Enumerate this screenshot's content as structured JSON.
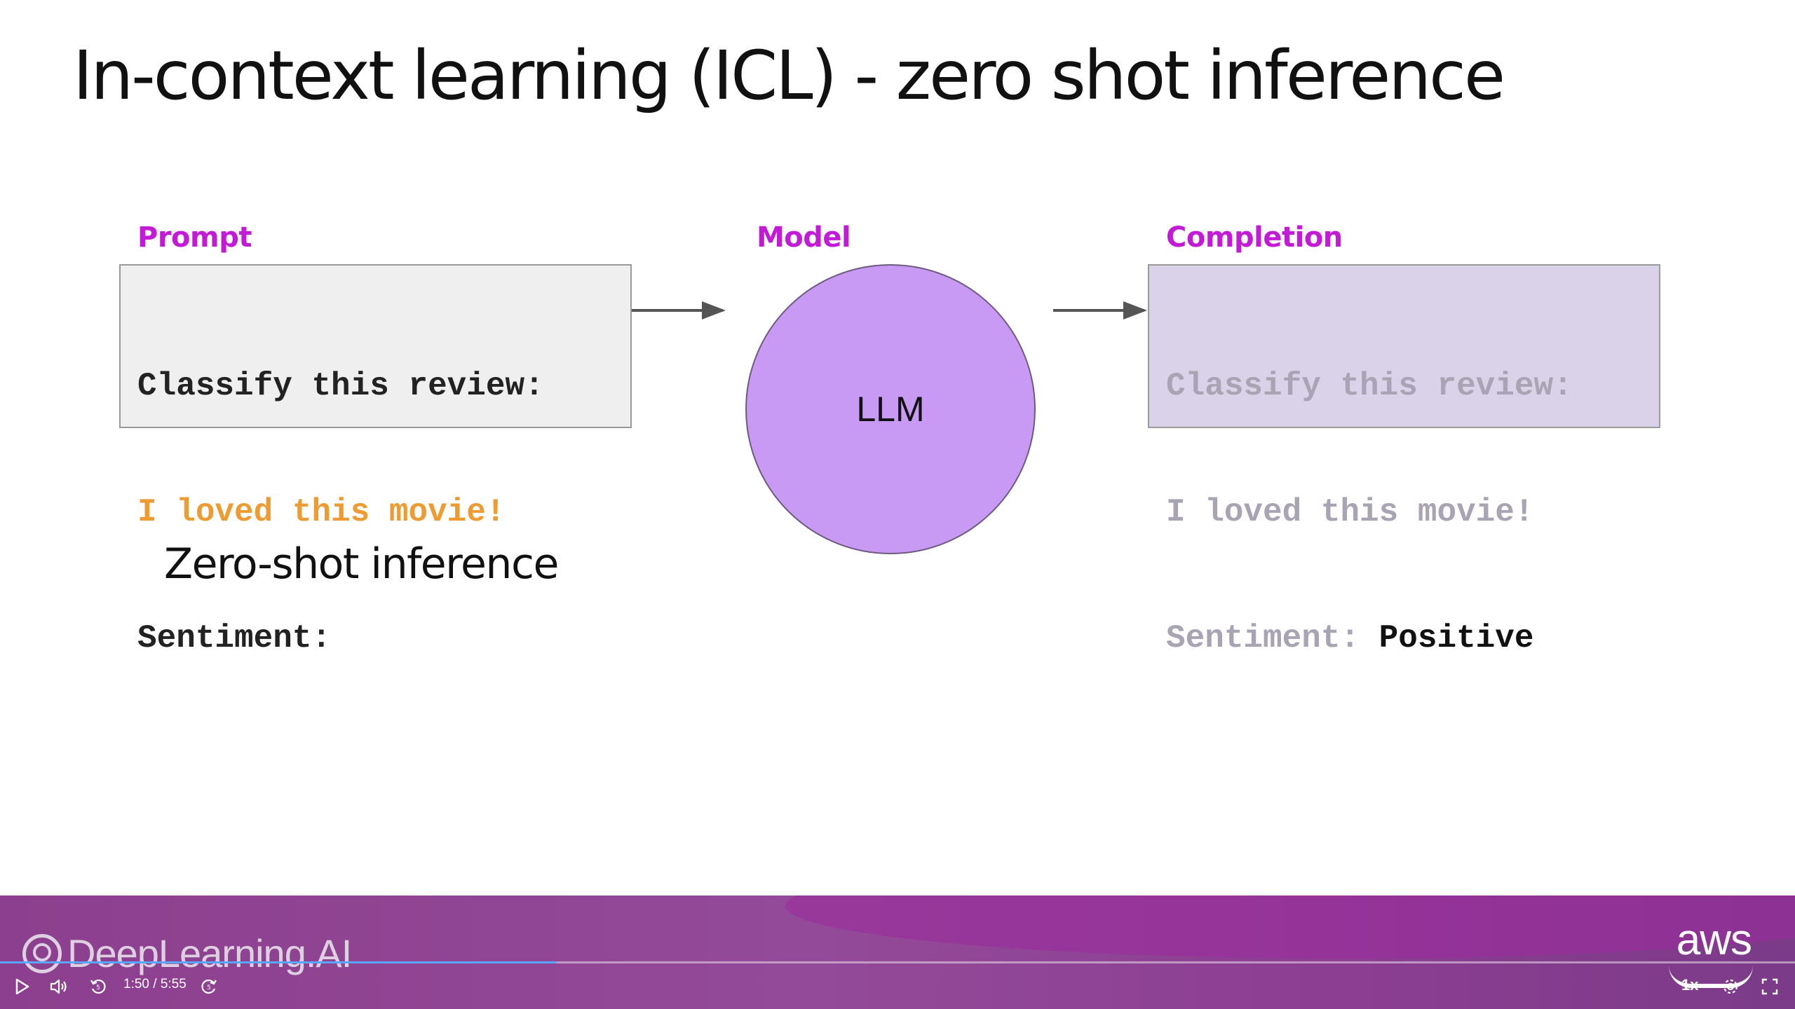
{
  "slide": {
    "title": "In-context learning (ICL) - zero shot inference",
    "labels": {
      "prompt": "Prompt",
      "model": "Model",
      "completion": "Completion"
    },
    "prompt_box": {
      "line1": "Classify this review:",
      "line2": "I loved this movie!",
      "line3": "Sentiment:"
    },
    "model_circle": "LLM",
    "completion_box": {
      "line1": "Classify this review:",
      "line2": "I loved this movie!",
      "line3_prefix": "Sentiment: ",
      "line3_answer": "Positive"
    },
    "caption": "Zero-shot inference"
  },
  "footer": {
    "brand": "DeepLearning.AI",
    "partner": "aws"
  },
  "player": {
    "time": "1:50 / 5:55",
    "speed": "1x",
    "progress_fraction": 0.31,
    "icons": [
      "play-icon",
      "volume-icon",
      "rewind-icon",
      "forward-icon",
      "settings-icon",
      "fullscreen-icon"
    ]
  },
  "colors": {
    "label_accent": "#c21ad6",
    "highlight_text": "#ee9b32",
    "llm_fill": "#c89af4",
    "completion_fill": "#d9d2e9",
    "footer_purple": "#8c3f8e",
    "progress": "#5aa6ff"
  }
}
